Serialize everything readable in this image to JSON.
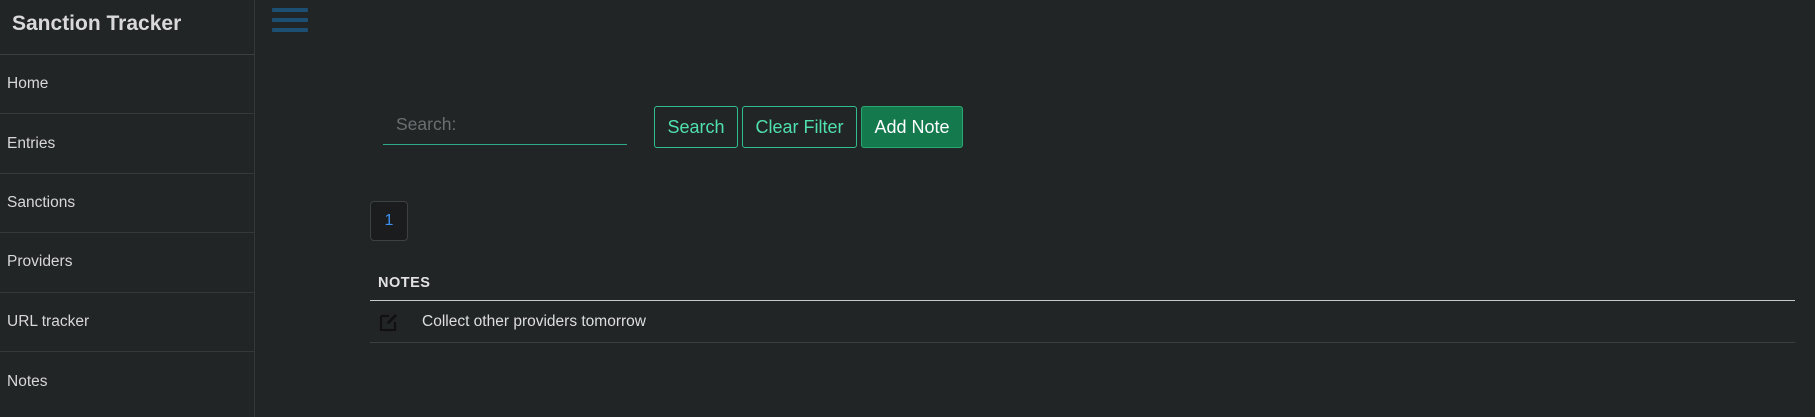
{
  "app": {
    "title": "Sanction Tracker"
  },
  "sidebar": {
    "items": [
      {
        "label": "Home"
      },
      {
        "label": "Entries"
      },
      {
        "label": "Sanctions"
      },
      {
        "label": "Providers"
      },
      {
        "label": "URL tracker"
      },
      {
        "label": "Notes"
      }
    ]
  },
  "toolbar": {
    "menu_icon": "hamburger-menu-icon",
    "search_placeholder": "Search:",
    "search_value": "",
    "search_label": "Search",
    "clear_label": "Clear Filter",
    "add_label": "Add Note"
  },
  "pagination": {
    "current_page": "1"
  },
  "notes": {
    "header": "NOTES",
    "rows": [
      {
        "icon": "edit-icon",
        "text": "Collect other providers tomorrow"
      }
    ]
  },
  "colors": {
    "background": "#222526",
    "accent_green": "#4fe0ad",
    "add_button_bg": "#147a4e",
    "menu_blue": "#1d4f73",
    "page_link_blue": "#3b8ff0"
  }
}
